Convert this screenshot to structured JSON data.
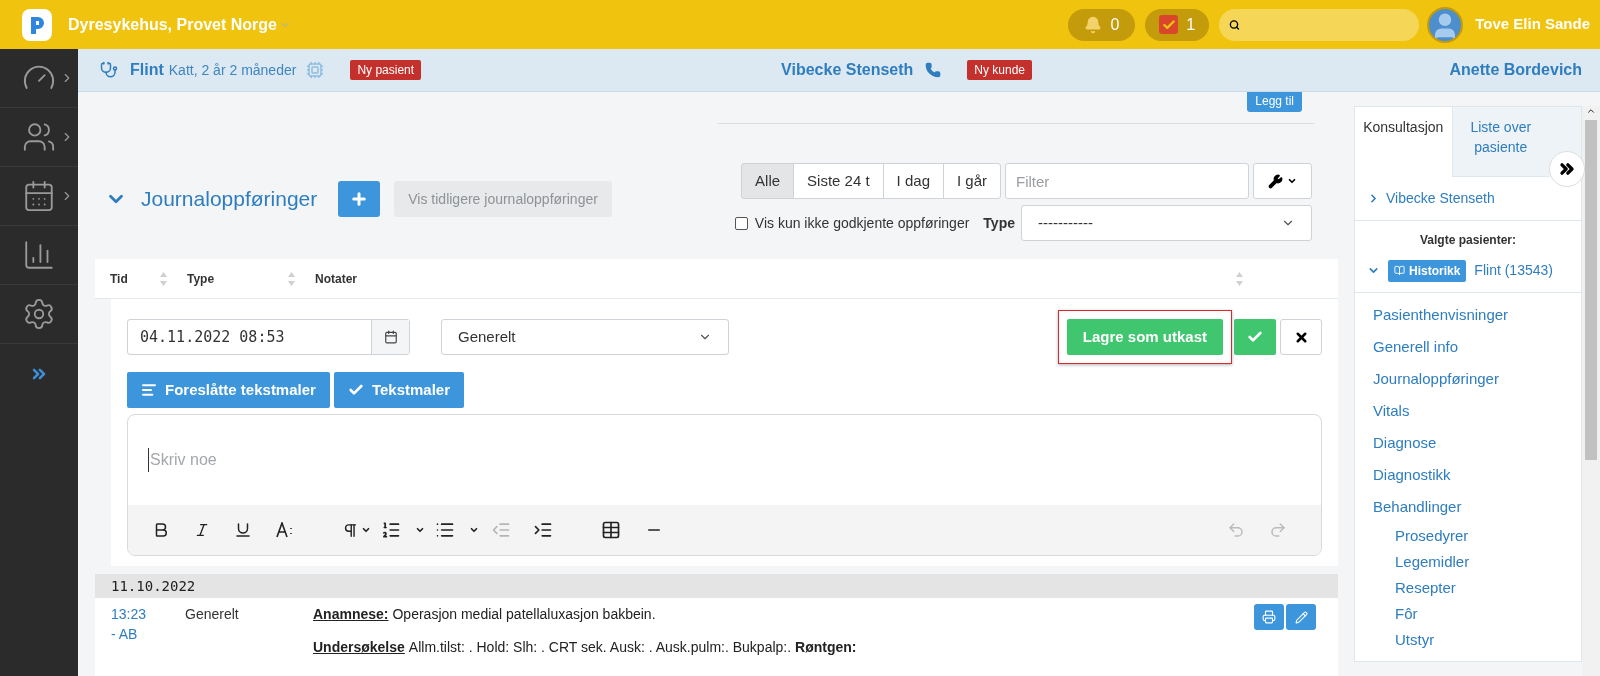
{
  "topbar": {
    "clinic": "Dyresykehus, Provet Norge",
    "notifications": "0",
    "tasks": "1",
    "user": "Tove Elin Sande"
  },
  "sidebar": {
    "items": [
      {
        "kind": "dashboard"
      },
      {
        "kind": "clients"
      },
      {
        "kind": "calendar"
      },
      {
        "kind": "reports"
      },
      {
        "kind": "settings"
      },
      {
        "kind": "expand"
      }
    ]
  },
  "patient_bar": {
    "patient": "Flint",
    "details": "Katt, 2 år 2 måneder",
    "patient_badge": "Ny pasient",
    "customer": "Vibecke Stenseth",
    "customer_badge": "Ny kunde",
    "vet": "Anette Bordevich"
  },
  "forms_section": {
    "add_button": "Legg til"
  },
  "journal": {
    "title": "Journaloppføringer",
    "expanded": true,
    "previous_button": "Vis tidligere journaloppføringer",
    "range_filters": [
      {
        "label": "Alle",
        "selected": true
      },
      {
        "label": "Siste 24 t",
        "selected": false
      },
      {
        "label": "I dag",
        "selected": false
      },
      {
        "label": "I går",
        "selected": false
      }
    ],
    "filter": {
      "placeholder": "Filter"
    },
    "only_unapproved": {
      "label": "Vis kun ikke godkjente oppføringer",
      "checked": false
    },
    "type_filter": {
      "label": "Type",
      "value": "-----------"
    },
    "columns": [
      {
        "label": "Tid",
        "sortable": true
      },
      {
        "label": "Type",
        "sortable": true
      },
      {
        "label": "Notater",
        "sortable": true
      }
    ],
    "new_entry": {
      "datetime": "04.11.2022 08:53",
      "type": "Generelt",
      "save_draft": "Lagre som utkast",
      "highlighted": true,
      "suggested_templates": "Foreslåtte tekstmaler",
      "templates": "Tekstmaler",
      "editor": {
        "placeholder": "Skriv noe"
      }
    },
    "days": [
      {
        "date": "11.10.2022",
        "entries": [
          {
            "time": "13:23",
            "author": "- AB",
            "type": "Generelt",
            "notes": [
              {
                "label": "Anamnese:",
                "text": "Operasjon medial patellaluxasjon bakbein."
              },
              {
                "label": "Undersøkelse",
                "text": "Allm.tilst: . Hold: Slh: . CRT sek. Ausk: . Ausk.pulm:. Bukpalp:. **Røntgen:**"
              }
            ]
          }
        ]
      }
    ]
  },
  "right_panel": {
    "tabs": [
      {
        "label": "Konsultasjon",
        "selected": true
      },
      {
        "label": "Liste over pasiente",
        "selected": false
      }
    ],
    "customer": "Vibecke Stenseth",
    "selected_title": "Valgte pasienter:",
    "history_button": "Historikk",
    "patient": "Flint (13543)",
    "patient_expanded": true,
    "nav": [
      {
        "label": "Pasienthenvisninger"
      },
      {
        "label": "Generell info"
      },
      {
        "label": "Journaloppføringer"
      },
      {
        "label": "Vitals"
      },
      {
        "label": "Diagnose"
      },
      {
        "label": "Diagnostikk"
      },
      {
        "label": "Behandlinger",
        "children": [
          {
            "label": "Prosedyrer"
          },
          {
            "label": "Legemidler"
          },
          {
            "label": "Resepter"
          },
          {
            "label": "Fôr"
          },
          {
            "label": "Utstyr"
          }
        ]
      }
    ]
  }
}
